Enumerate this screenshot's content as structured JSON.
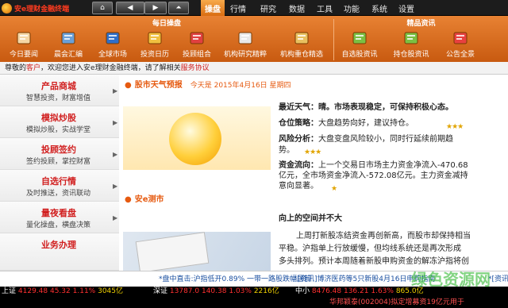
{
  "app": {
    "logo_text": "安e理财金融终端"
  },
  "nav_buttons": {
    "home": "⌂",
    "prev": "◀",
    "next": "▶",
    "up": "⏶"
  },
  "menu": [
    "操盘",
    "行情",
    "研究",
    "数据",
    "工具",
    "功能",
    "系统",
    "设置"
  ],
  "ribbon": {
    "group_daily": "每日操盘",
    "group_premium": "精品资讯",
    "tools": [
      {
        "label": "今日要闻",
        "icon": "newspaper-icon",
        "color": "#f5d6a5"
      },
      {
        "label": "晨会汇编",
        "icon": "meeting-icon",
        "color": "#6aa0d8"
      },
      {
        "label": "全球市场",
        "icon": "globe-icon",
        "color": "#2f6fc9"
      },
      {
        "label": "投资日历",
        "icon": "calendar-icon",
        "color": "#f0c040"
      },
      {
        "label": "投顾组合",
        "icon": "portfolio-icon",
        "color": "#e04040"
      },
      {
        "label": "机构研究精粹",
        "icon": "research-icon",
        "color": "#e8e8e8"
      },
      {
        "label": "机构重仓精选",
        "icon": "holdings-icon",
        "color": "#e8c060"
      },
      {
        "label": "自选股资讯",
        "icon": "watchlist-info-icon",
        "color": "#7ac043"
      },
      {
        "label": "持仓股资讯",
        "icon": "position-info-icon",
        "color": "#7ac043"
      },
      {
        "label": "公告全景",
        "icon": "announcement-icon",
        "color": "#e84040"
      }
    ]
  },
  "status": {
    "pre": "尊敬的",
    "user": "客户",
    "msg": "，欢迎您进入安e理财金融终端，请了解相关",
    "link": "服务协议"
  },
  "sidebar": {
    "items": [
      {
        "title": "产品商城",
        "sub": "智慧投资，财富增值"
      },
      {
        "title": "模拟炒股",
        "sub": "模拟炒股，实战学堂"
      },
      {
        "title": "投顾签约",
        "sub": "签约投顾，掌控财富"
      },
      {
        "title": "自选行情",
        "sub": "及时推送，资讯联动"
      },
      {
        "title": "量夜看盘",
        "sub": "量化操盘，横盘决策"
      },
      {
        "title": "业务办理",
        "sub": ""
      }
    ]
  },
  "weather": {
    "section_title": "股市天气预报",
    "date": "今天是 2015年4月16日 星期四",
    "headline": "最近天气：晴。市场表现稳定，可保持积极心态。",
    "position_label": "仓位策略：",
    "position_text": "大盘趋势向好，建议持仓。",
    "position_stars": "★★★",
    "risk_label": "风险分析：",
    "risk_text": "大盘变盘风险较小，同时行延续前期趋",
    "risk_text2": "势。",
    "risk_stars": "★★★",
    "flow_label": "资金流向：",
    "flow_text1": "上一个交易日市场主力资金净流入-470.68",
    "flow_text2": "亿元，全市场资金净流入-572.08亿元。主力资金减持",
    "flow_text3": "意向显著。",
    "flow_stars": "★"
  },
  "news": {
    "section_title": "安e测市",
    "headline": "向上的空间并不大",
    "line1": "上周打新股冻结资金再创新高，而股市却保持相当",
    "line2": "平稳。沪指单上行放缓慢，但均线系统还是再次形成",
    "line3": "多头排列。预计本周随着新股申购资金的解冻沪指将创"
  },
  "ticker": {
    "t1": "*盘中直击:沪指低开0.89% 一带一路股跌幅居前",
    "t2": "*[资讯]博济医药等5只新股4月16日申购指南",
    "t3": "*[资讯]"
  },
  "bottom": {
    "row1": [
      {
        "name": "上证",
        "value": "4129.48",
        "chg": "45.32",
        "pct": "1.11%",
        "vol": "3045亿"
      },
      {
        "name": "深证",
        "value": "13787.0",
        "chg": "140.38",
        "pct": "1.03%",
        "vol": "2216亿"
      },
      {
        "name": "中小",
        "value": "8476.48",
        "chg": "136.21",
        "pct": "1.63%",
        "vol": "865.0亿"
      }
    ],
    "row2": "华邦颖泰(002004)拟定增募资19亿元用于"
  },
  "watermark": "绿色资源网"
}
